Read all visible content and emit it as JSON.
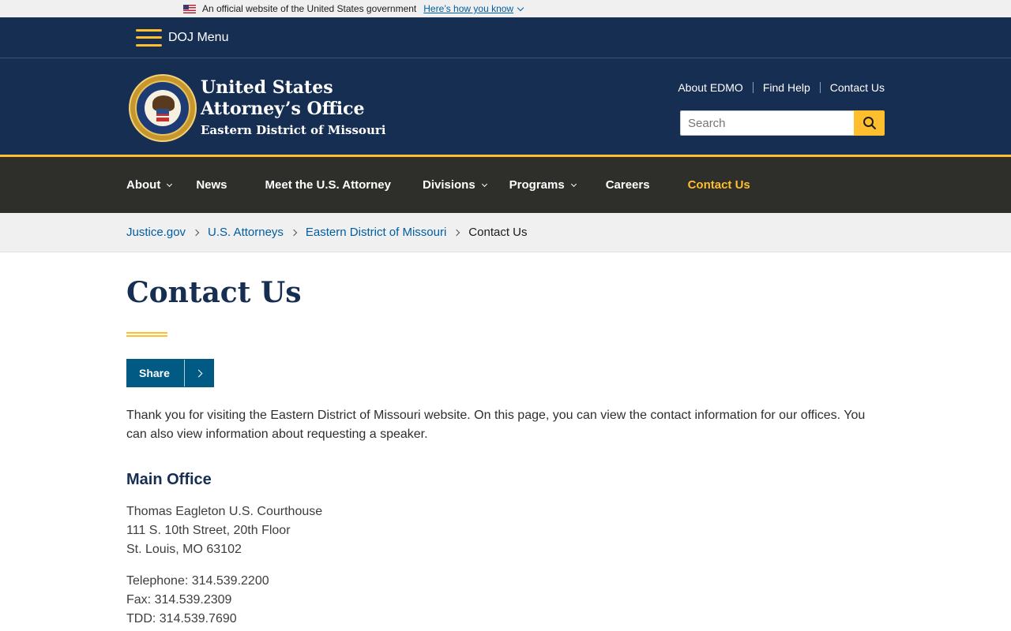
{
  "gov_banner": {
    "text": "An official website of the United States government",
    "link": "Here’s how you know",
    "flag_icon": "us-flag-icon"
  },
  "doj_menu": {
    "label": "DOJ Menu",
    "icon": "hamburger-icon"
  },
  "header": {
    "title_line1": "United States",
    "title_line2": "Attorney’s Office",
    "title_line3": "Eastern District of Missouri",
    "seal_icon": "doj-seal-icon",
    "util_links": [
      "About EDMO",
      "Find Help",
      "Contact Us"
    ],
    "search_placeholder": "Search",
    "search_icon": "search-icon",
    "accent_color": "#ffbe2e",
    "brand_color": "#162e51"
  },
  "nav": {
    "items": [
      {
        "label": "About",
        "has_dropdown": true
      },
      {
        "label": "News",
        "has_dropdown": false
      },
      {
        "label": "Meet the U.S. Attorney",
        "has_dropdown": false
      },
      {
        "label": "Divisions",
        "has_dropdown": true
      },
      {
        "label": "Programs",
        "has_dropdown": true
      },
      {
        "label": "Careers",
        "has_dropdown": false
      },
      {
        "label": "Contact Us",
        "has_dropdown": false,
        "active": true
      }
    ]
  },
  "breadcrumb": {
    "links": [
      "Justice.gov",
      "U.S. Attorneys",
      "Eastern District of Missouri"
    ],
    "current": "Contact Us"
  },
  "main": {
    "title": "Contact Us",
    "share_label": "Share",
    "intro": "Thank you for visiting the Eastern District of Missouri website. On this page, you can view the contact information for our offices. You can also view information about requesting a speaker.",
    "main_office": {
      "heading": "Main Office",
      "address": [
        "Thomas Eagleton U.S. Courthouse",
        "111 S. 10th Street, 20th Floor",
        "St. Louis, MO 63102"
      ],
      "phones": [
        "Telephone: 314.539.2200",
        "Fax: 314.539.2309",
        "TDD: 314.539.7690"
      ]
    }
  }
}
